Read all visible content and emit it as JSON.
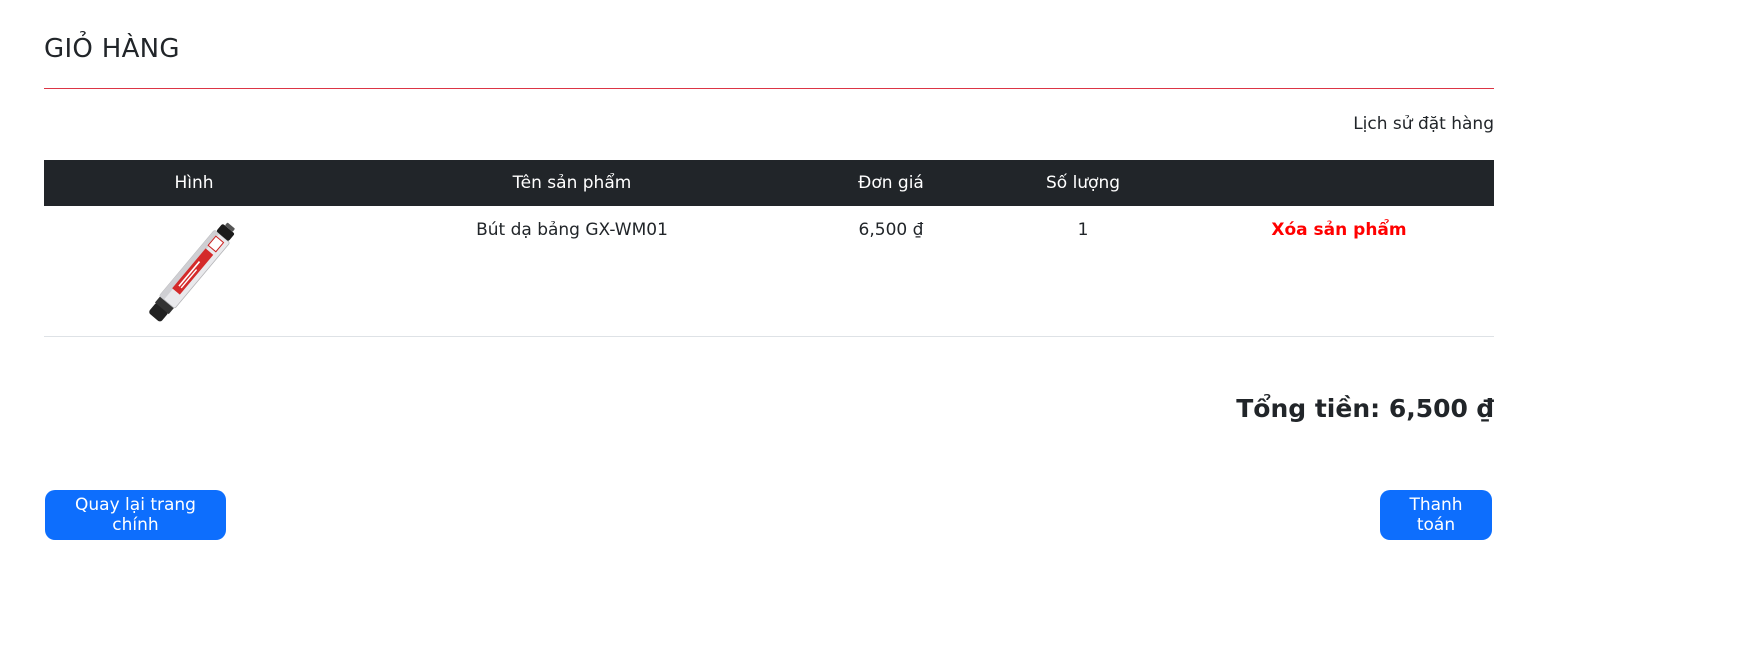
{
  "header": {
    "title": "GIỎ HÀNG",
    "history_link": "Lịch sử đặt hàng"
  },
  "table": {
    "columns": [
      "Hình",
      "Tên sản phẩm",
      "Đơn giá",
      "Số lượng",
      ""
    ],
    "rows": [
      {
        "image_icon": "whiteboard-marker-image",
        "name": "Bút dạ bảng GX-WM01",
        "price": "6,500 ₫",
        "quantity": "1",
        "action": "Xóa sản phẩm"
      }
    ]
  },
  "summary": {
    "total": "Tổng tiền: 6,500 ₫"
  },
  "buttons": {
    "back": "Quay lại trang chính",
    "checkout": "Thanh toán"
  },
  "colors": {
    "accent_rule": "#dc3545",
    "header_bg": "#212529",
    "button_bg": "#0d6efd",
    "delete_text": "#ff0000"
  }
}
